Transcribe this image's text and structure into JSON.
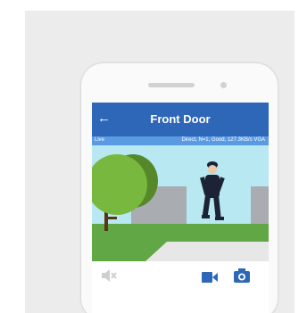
{
  "header": {
    "title": "Front Door",
    "back_icon": "arrow-left-icon"
  },
  "status": {
    "mode": "Live",
    "connection_info": "Direct, N=1, Good, 127.3KB/s VGA"
  },
  "controls": {
    "mute_icon": "speaker-muted-icon",
    "record_icon": "video-camera-icon",
    "snapshot_icon": "camera-icon"
  },
  "colors": {
    "appbar": "#2e66b8",
    "statusbar": "#5a9ae2",
    "control_active": "#2e66b8",
    "control_inactive": "#cfcfcf"
  }
}
